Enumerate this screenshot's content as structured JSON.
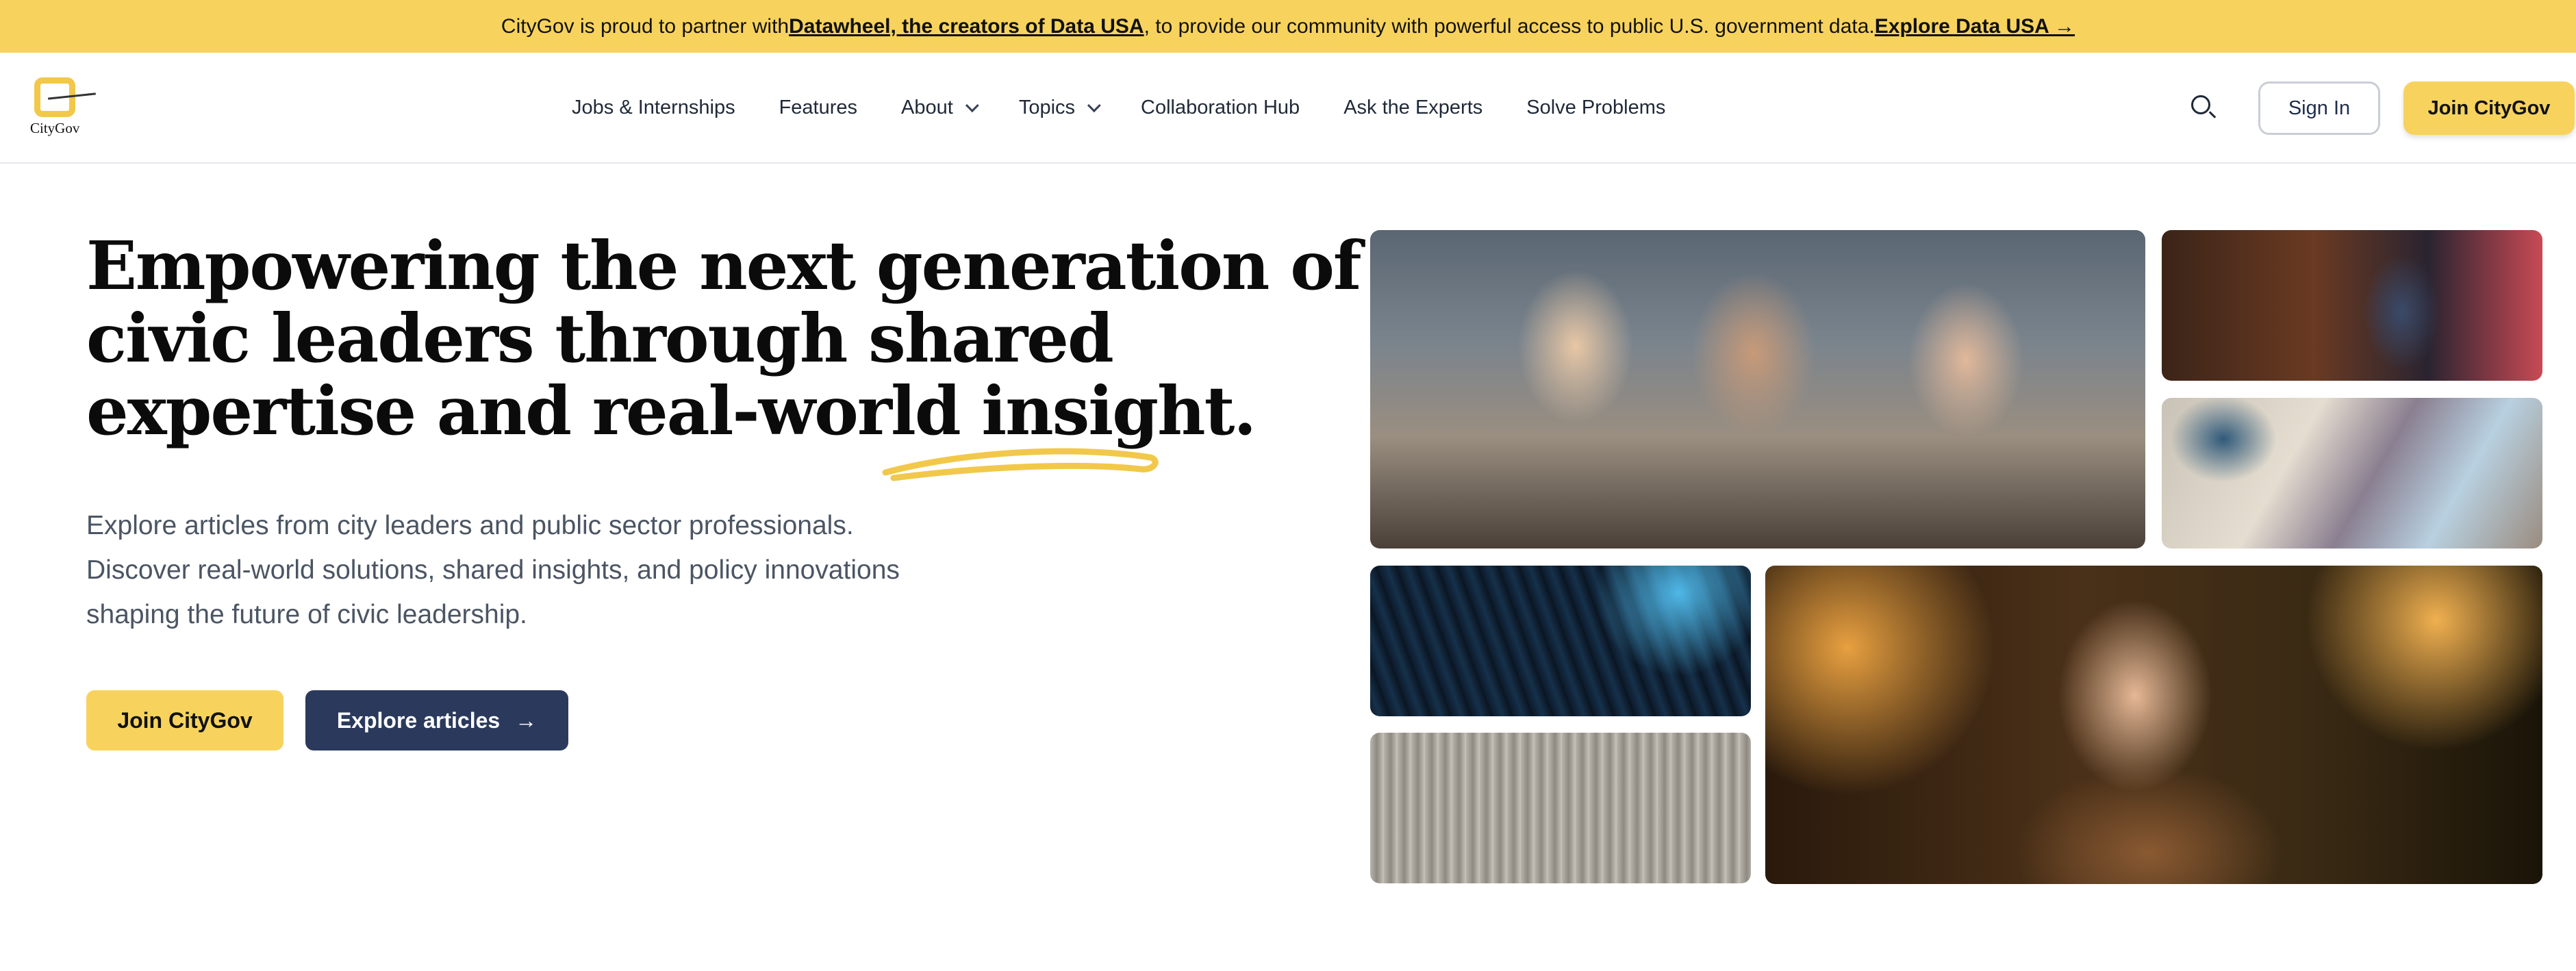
{
  "banner": {
    "prefix": "CityGov is proud to partner with ",
    "partner_link": "Datawheel, the creators of Data USA",
    "middle": ", to provide our community with powerful access to public U.S. government data. ",
    "cta_link": "Explore Data USA →"
  },
  "header": {
    "logo_text": "CityGov",
    "nav": [
      {
        "label": "Jobs & Internships"
      },
      {
        "label": "Features"
      },
      {
        "label": "About"
      },
      {
        "label": "Topics"
      },
      {
        "label": "Collaboration Hub"
      },
      {
        "label": "Ask the Experts"
      },
      {
        "label": "Solve Problems"
      }
    ],
    "signin_label": "Sign In",
    "join_label": "Join CityGov"
  },
  "hero": {
    "headline_lines": [
      "Empowering the next generation of",
      "civic leaders through shared",
      "expertise and real-world insight."
    ],
    "subtext_lines": [
      "Explore articles from city leaders and public sector professionals.",
      "Discover real-world solutions, shared insights, and policy innovations",
      "shaping the future of civic leadership."
    ],
    "join_label": "Join CityGov",
    "explore_label": "Explore articles",
    "explore_arrow": "→"
  },
  "colors": {
    "accent_yellow": "#f7d35e",
    "navy": "#2b3a5c"
  }
}
